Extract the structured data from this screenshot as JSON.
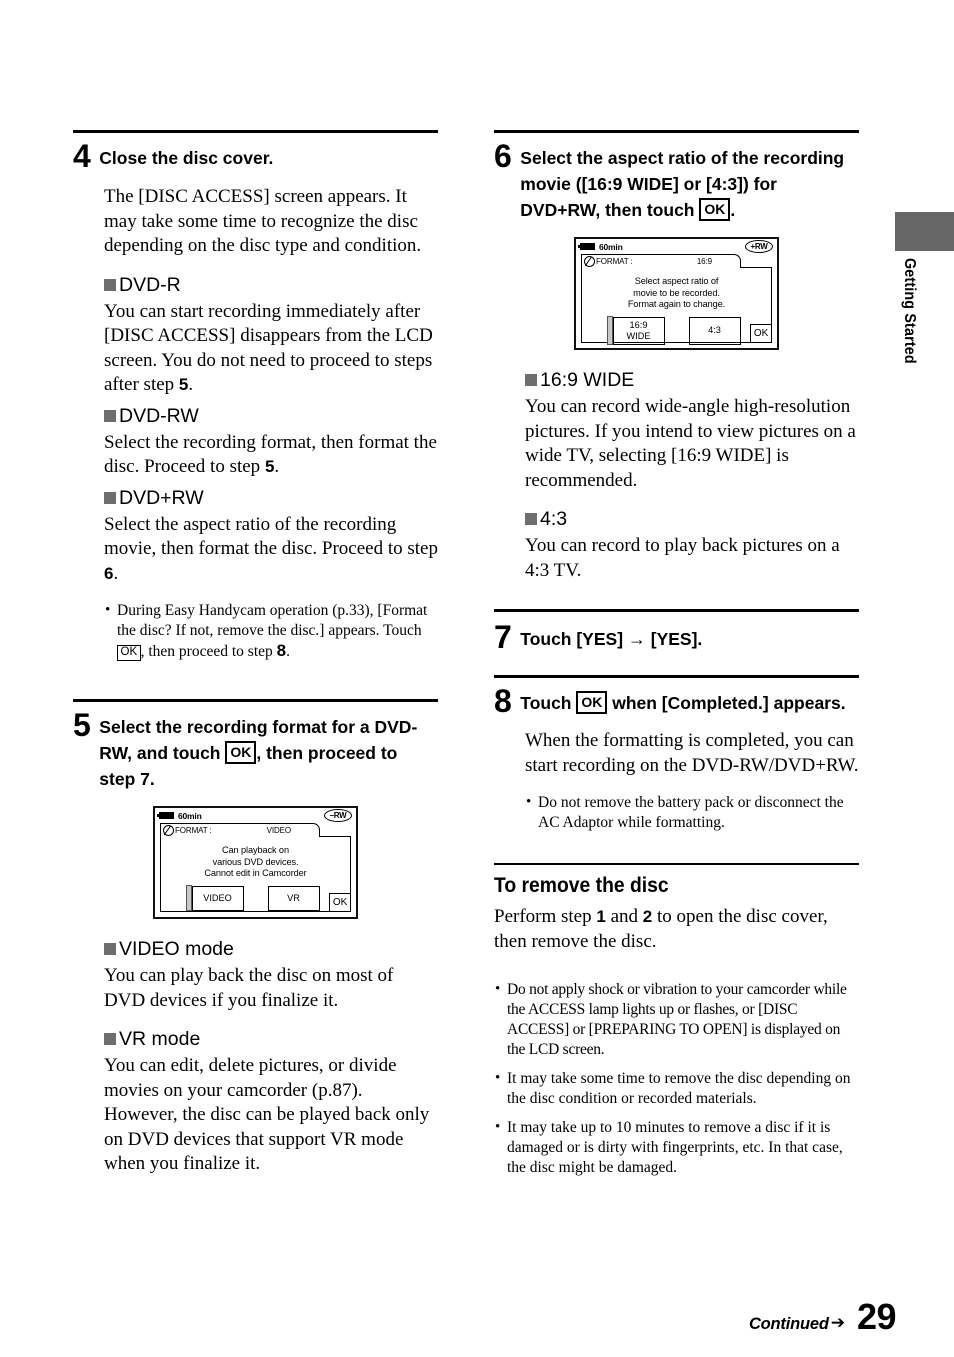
{
  "page": {
    "number": "29",
    "continued_label": "Continued",
    "side_tab_label": "Getting Started",
    "side_tab_color": "#666666"
  },
  "left_column": {
    "step4": {
      "number": "4",
      "title": "Close the disc cover.",
      "intro": "The [DISC ACCESS] screen appears. It may take some time to recognize the disc depending on the disc type and condition.",
      "sections": [
        {
          "head": "DVD-R",
          "body_pre": "You can start recording immediately after [DISC ACCESS] disappears from the LCD screen. You do not need to proceed to steps after step ",
          "body_bold": "5",
          "body_post": "."
        },
        {
          "head": "DVD-RW",
          "body_pre": "Select the recording format, then format the disc. Proceed to step ",
          "body_bold": "5",
          "body_post": "."
        },
        {
          "head": "DVD+RW",
          "body_pre": "Select the aspect ratio of the recording movie, then format the disc. Proceed to step ",
          "body_bold": "6",
          "body_post": "."
        }
      ],
      "note_pre": "During Easy Handycam operation (p.33), [Format the disc? If not, remove the disc.] appears. Touch ",
      "note_ok": "OK",
      "note_mid": ", then proceed to step ",
      "note_bold": "8",
      "note_post": "."
    },
    "step5": {
      "number": "5",
      "title_part1": "Select the recording format for a DVD-RW, and touch ",
      "title_ok": "OK",
      "title_part2": ", then proceed to step 7.",
      "lcd": {
        "battery_time": "60min",
        "disc_badge": "–RW",
        "tab_label": "FORMAT :",
        "tab_value": "VIDEO",
        "message_lines": [
          "Can playback on",
          "various DVD devices.",
          "Cannot edit in Camcorder"
        ],
        "buttons": [
          {
            "label": "VIDEO",
            "selected": true
          },
          {
            "label": "VR",
            "selected": false
          }
        ],
        "ok_label": "OK"
      },
      "sections": [
        {
          "head": "VIDEO mode",
          "body": "You can play back the disc on most of DVD devices if you finalize it."
        },
        {
          "head": "VR mode",
          "body": "You can edit, delete pictures, or divide movies on your camcorder (p.87). However, the disc can be played back only on DVD devices that support VR mode when you finalize it."
        }
      ]
    }
  },
  "right_column": {
    "step6": {
      "number": "6",
      "title_part1": "Select the aspect ratio of the recording movie ([16:9 WIDE] or [4:3]) for DVD+RW, then touch ",
      "title_ok": "OK",
      "title_part2": ".",
      "lcd": {
        "battery_time": "60min",
        "disc_badge": "+RW",
        "tab_label": "FORMAT :",
        "tab_value": "16:9",
        "message_lines": [
          "Select aspect ratio of",
          "movie to be recorded.",
          "Format again to change."
        ],
        "buttons": [
          {
            "label": "16:9\nWIDE",
            "selected": true
          },
          {
            "label": "4:3",
            "selected": false
          }
        ],
        "ok_label": "OK"
      },
      "sections": [
        {
          "head": "16:9 WIDE",
          "body": "You can record wide-angle high-resolution pictures. If you intend to view pictures on a wide TV, selecting [16:9 WIDE] is recommended."
        },
        {
          "head": "4:3",
          "body": "You can record to play back pictures on a 4:3 TV."
        }
      ]
    },
    "step7": {
      "number": "7",
      "title_pre": "Touch [YES] ",
      "title_arrow": "→",
      "title_post": " [YES]."
    },
    "step8": {
      "number": "8",
      "title_pre": "Touch ",
      "title_ok": "OK",
      "title_post": " when [Completed.] appears.",
      "body": "When the formatting is completed, you can start recording on the DVD-RW/DVD+RW.",
      "note": "Do not remove the battery pack or disconnect the AC Adaptor while formatting."
    },
    "remove_section": {
      "heading": "To remove the disc",
      "body_pre": "Perform step ",
      "body_b1": "1",
      "body_mid": " and ",
      "body_b2": "2",
      "body_post": " to open the disc cover, then remove the disc.",
      "notes": [
        "Do not apply shock or vibration to your camcorder while the ACCESS lamp lights up or flashes, or [DISC ACCESS] or [PREPARING TO OPEN] is displayed on the LCD screen.",
        "It may take some time to remove the disc depending on the disc condition or recorded materials.",
        "It may take up to 10 minutes to remove a disc if it is damaged or is dirty with fingerprints, etc. In that case, the disc might be damaged."
      ]
    }
  }
}
